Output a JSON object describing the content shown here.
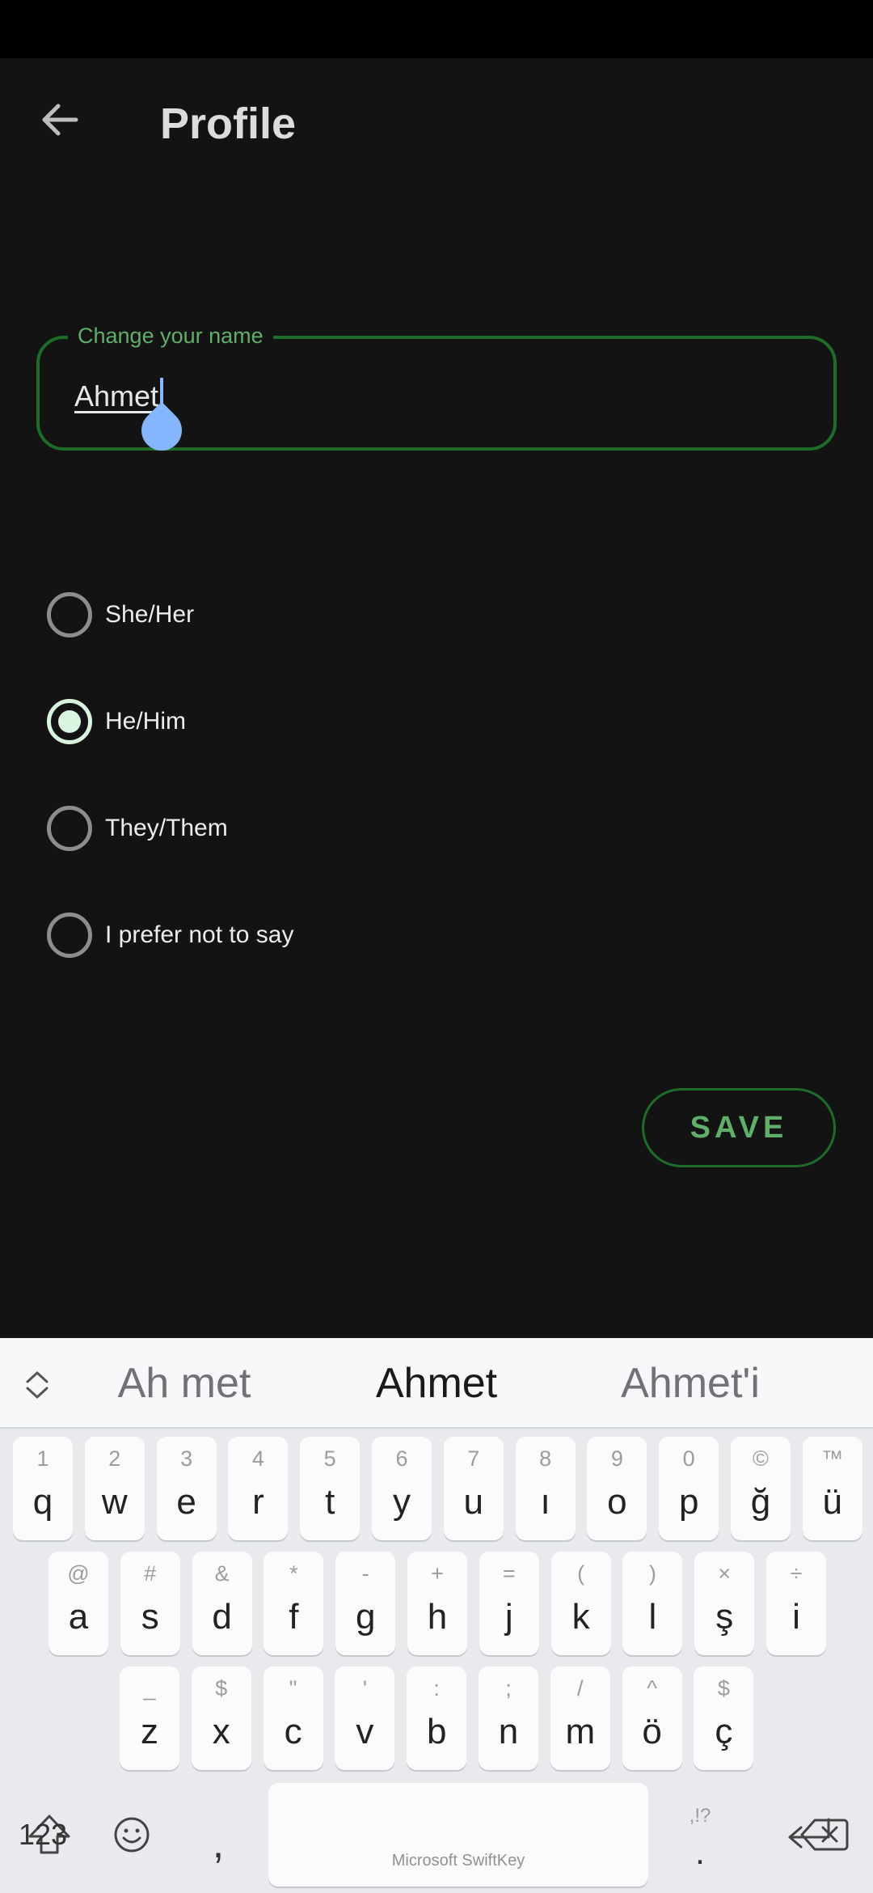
{
  "app": {
    "title": "Profile"
  },
  "name_field": {
    "label": "Change your name",
    "value": "Ahmet"
  },
  "pronouns": [
    {
      "label": "She/Her",
      "checked": false
    },
    {
      "label": "He/Him",
      "checked": true
    },
    {
      "label": "They/Them",
      "checked": false
    },
    {
      "label": "I prefer not to say",
      "checked": false
    }
  ],
  "save_label": "SAVE",
  "colors": {
    "background": "#131313",
    "accent_green": "#5fae6a",
    "border_green": "#1f6b2a",
    "caret_blue": "#86b6ff"
  },
  "keyboard": {
    "suggestions": [
      "Ah met",
      "Ahmet",
      "Ahmet'i"
    ],
    "row1": [
      {
        "k": "q",
        "h": "1"
      },
      {
        "k": "w",
        "h": "2"
      },
      {
        "k": "e",
        "h": "3"
      },
      {
        "k": "r",
        "h": "4"
      },
      {
        "k": "t",
        "h": "5"
      },
      {
        "k": "y",
        "h": "6"
      },
      {
        "k": "u",
        "h": "7"
      },
      {
        "k": "ı",
        "h": "8"
      },
      {
        "k": "o",
        "h": "9"
      },
      {
        "k": "p",
        "h": "0"
      },
      {
        "k": "ğ",
        "h": "©"
      },
      {
        "k": "ü",
        "h": "™"
      }
    ],
    "row2": [
      {
        "k": "a",
        "h": "@"
      },
      {
        "k": "s",
        "h": "#"
      },
      {
        "k": "d",
        "h": "&"
      },
      {
        "k": "f",
        "h": "*"
      },
      {
        "k": "g",
        "h": "-"
      },
      {
        "k": "h",
        "h": "+"
      },
      {
        "k": "j",
        "h": "="
      },
      {
        "k": "k",
        "h": "("
      },
      {
        "k": "l",
        "h": ")"
      },
      {
        "k": "ş",
        "h": "×"
      },
      {
        "k": "i",
        "h": "÷"
      }
    ],
    "row3": [
      {
        "k": "z",
        "h": "_"
      },
      {
        "k": "x",
        "h": "$"
      },
      {
        "k": "c",
        "h": "\""
      },
      {
        "k": "v",
        "h": "'"
      },
      {
        "k": "b",
        "h": ":"
      },
      {
        "k": "n",
        "h": ";"
      },
      {
        "k": "m",
        "h": "/"
      },
      {
        "k": "ö",
        "h": "^"
      },
      {
        "k": "ç",
        "h": "$"
      }
    ],
    "numbers_label": "123",
    "comma": ",",
    "space_brand": "Microsoft SwiftKey",
    "period": ".",
    "period_hint": ",!?",
    "icons": {
      "shift": "shift-icon",
      "backspace": "backspace-icon",
      "emoji": "emoji-icon",
      "enter": "enter-icon",
      "expand": "expand-icon"
    }
  }
}
